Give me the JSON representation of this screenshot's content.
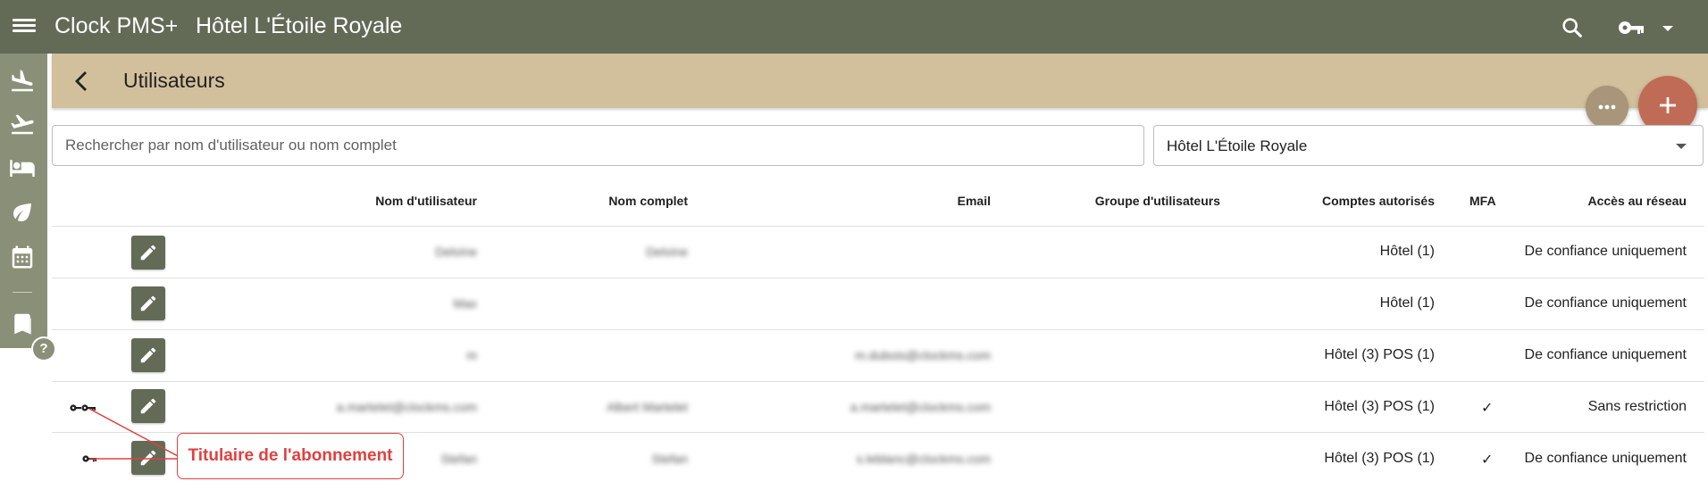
{
  "app": {
    "title": "Clock PMS+",
    "hotel": "Hôtel L'Étoile Royale"
  },
  "sidebar": {
    "items": [
      {
        "icon": "flight-land-icon",
        "label": "Arrivées"
      },
      {
        "icon": "flight-takeoff-icon",
        "label": "Départs"
      },
      {
        "icon": "bed-icon",
        "label": "Chambres"
      },
      {
        "icon": "leaf-icon",
        "label": "Eco"
      },
      {
        "icon": "calendar-icon",
        "label": "Calendrier"
      },
      {
        "icon": "book-icon",
        "label": "Réservations"
      }
    ],
    "help_label": "?"
  },
  "page": {
    "title": "Utilisateurs"
  },
  "filters": {
    "search_placeholder": "Rechercher par nom d'utilisateur ou nom complet",
    "hotel_selected": "Hôtel L'Étoile Royale"
  },
  "table": {
    "headers": {
      "username": "Nom d'utilisateur",
      "fullname": "Nom complet",
      "email": "Email",
      "group": "Groupe d'utilisateurs",
      "accounts": "Comptes autorisés",
      "mfa": "MFA",
      "network": "Accès au réseau"
    },
    "rows": [
      {
        "username": "Delvine",
        "fullname": "Delvine",
        "email": "",
        "accounts": "Hôtel (1)",
        "mfa": "",
        "network": "De confiance uniquement",
        "key": ""
      },
      {
        "username": "Max",
        "fullname": "",
        "email": "",
        "accounts": "Hôtel (1)",
        "mfa": "",
        "network": "De confiance uniquement",
        "key": ""
      },
      {
        "username": "m",
        "fullname": "",
        "email": "m.dubois@clockms.com",
        "accounts": "Hôtel (3) POS (1)",
        "mfa": "",
        "network": "De confiance uniquement",
        "key": ""
      },
      {
        "username": "a.martelet@clockms.com",
        "fullname": "Albert Martelet",
        "email": "a.martelet@clockms.com",
        "accounts": "Hôtel (3) POS (1)",
        "mfa": "✓",
        "network": "Sans restriction",
        "key": "double"
      },
      {
        "username": "Stefan",
        "fullname": "Stefan",
        "email": "s.leblanc@clockms.com",
        "accounts": "Hôtel (3) POS (1)",
        "mfa": "✓",
        "network": "De confiance uniquement",
        "key": "single"
      }
    ]
  },
  "callout": {
    "text": "Titulaire de l'abonnement"
  },
  "colors": {
    "topbar": "#636b57",
    "subheader": "#d2c09c",
    "fab_add": "#c06b55",
    "fab_more": "#a8957a",
    "callout": "#e04040"
  }
}
